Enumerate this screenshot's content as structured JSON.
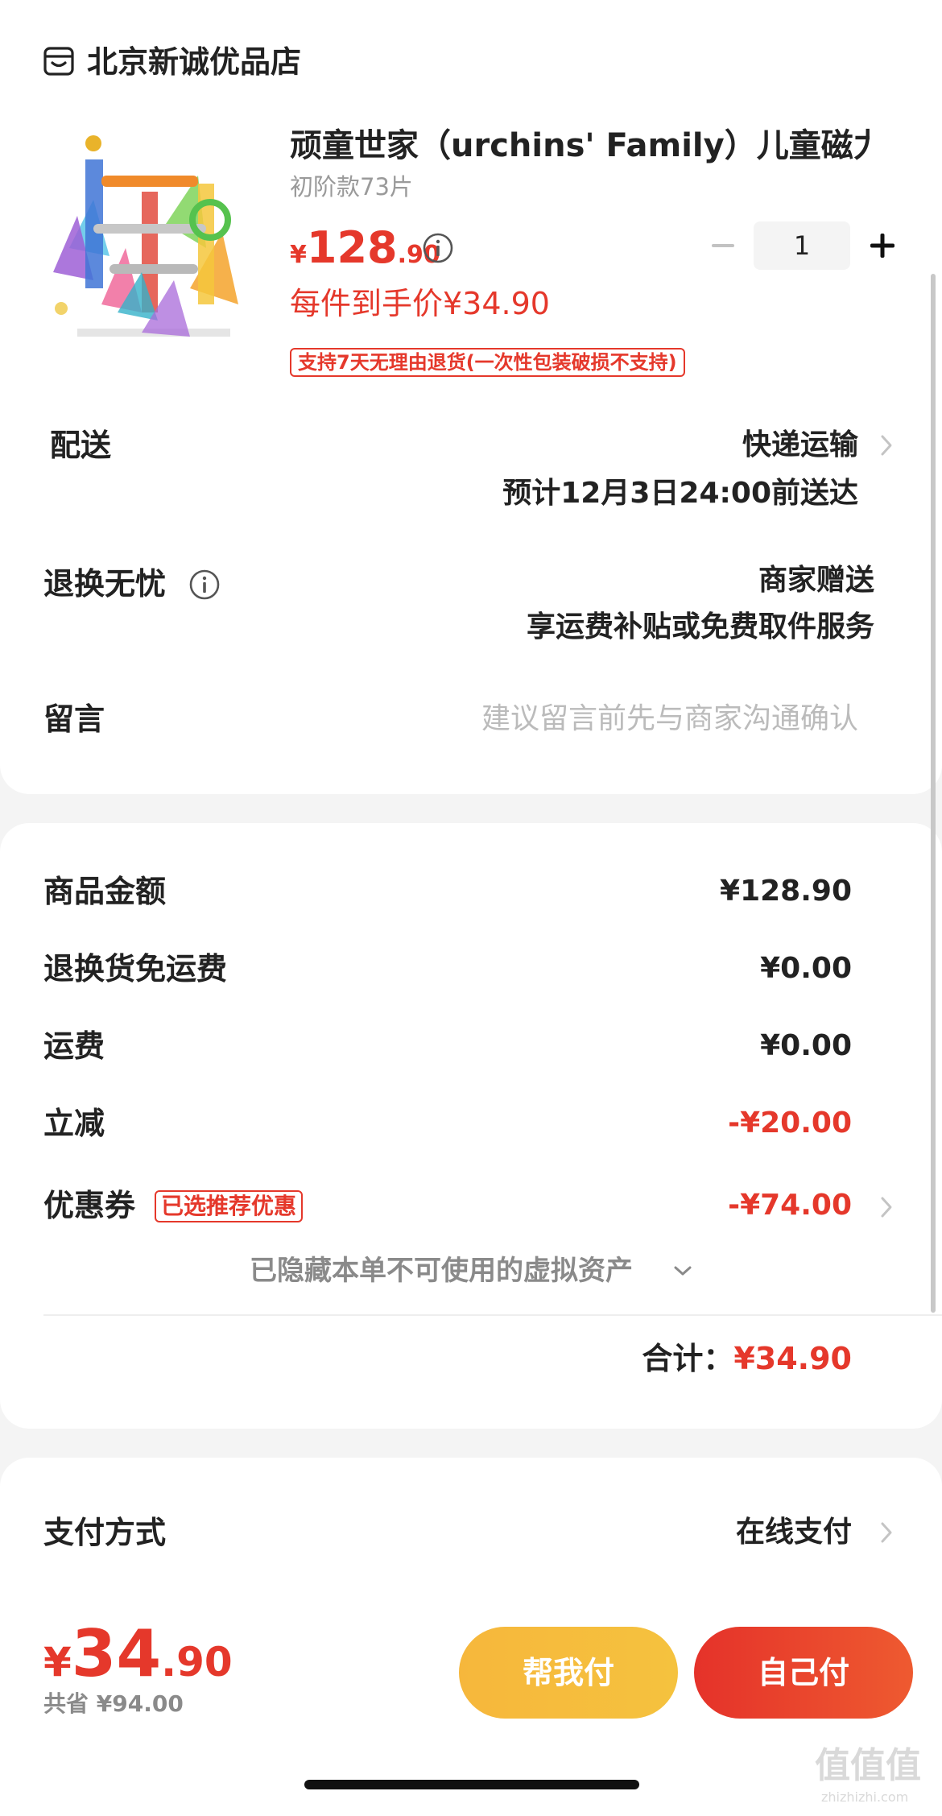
{
  "shop": {
    "name": "北京新诚优品店",
    "icon": "store-icon"
  },
  "product": {
    "title": "顽童世家（urchins' Family）儿童磁力...",
    "spec": "初阶款73片",
    "price_currency": "¥",
    "price_integer": "128",
    "price_decimal": ".90",
    "unit_price": "每件到手价¥34.90",
    "return_policy": "支持7天无理由退货(一次性包装破损不支持)",
    "quantity": "1",
    "image": "magnetic-marble-run-toy-image"
  },
  "delivery": {
    "label": "配送",
    "method": "快递运输",
    "eta": "预计12月3日24:00前送达"
  },
  "exchange": {
    "label": "退换无忧",
    "provider": "商家赠送",
    "detail": "享运费补贴或免费取件服务"
  },
  "message": {
    "label": "留言",
    "placeholder": "建议留言前先与商家沟通确认"
  },
  "summary": {
    "goods_label": "商品金额",
    "goods_value": "¥128.90",
    "exchange_free_label": "退换货免运费",
    "exchange_free_value": "¥0.00",
    "shipping_label": "运费",
    "shipping_value": "¥0.00",
    "reduction_label": "立减",
    "reduction_value": "-¥20.00",
    "coupon_label": "优惠券",
    "coupon_badge": "已选推荐优惠",
    "coupon_value": "-¥74.00",
    "hidden_assets": "已隐藏本单不可使用的虚拟资产",
    "total_label": "合计：",
    "total_value": "¥34.90"
  },
  "payment": {
    "label": "支付方式",
    "value": "在线支付"
  },
  "bottom": {
    "currency": "¥",
    "integer": "34",
    "decimal": ".90",
    "saved": "共省 ¥94.00",
    "help_pay": "帮我付",
    "self_pay": "自己付"
  },
  "watermark": {
    "text": "值值值",
    "sub": "zhizhizhi.com"
  },
  "colors": {
    "accent": "#e5382b",
    "help_pay": "#f6b73c",
    "self_pay": "#e5322a"
  }
}
